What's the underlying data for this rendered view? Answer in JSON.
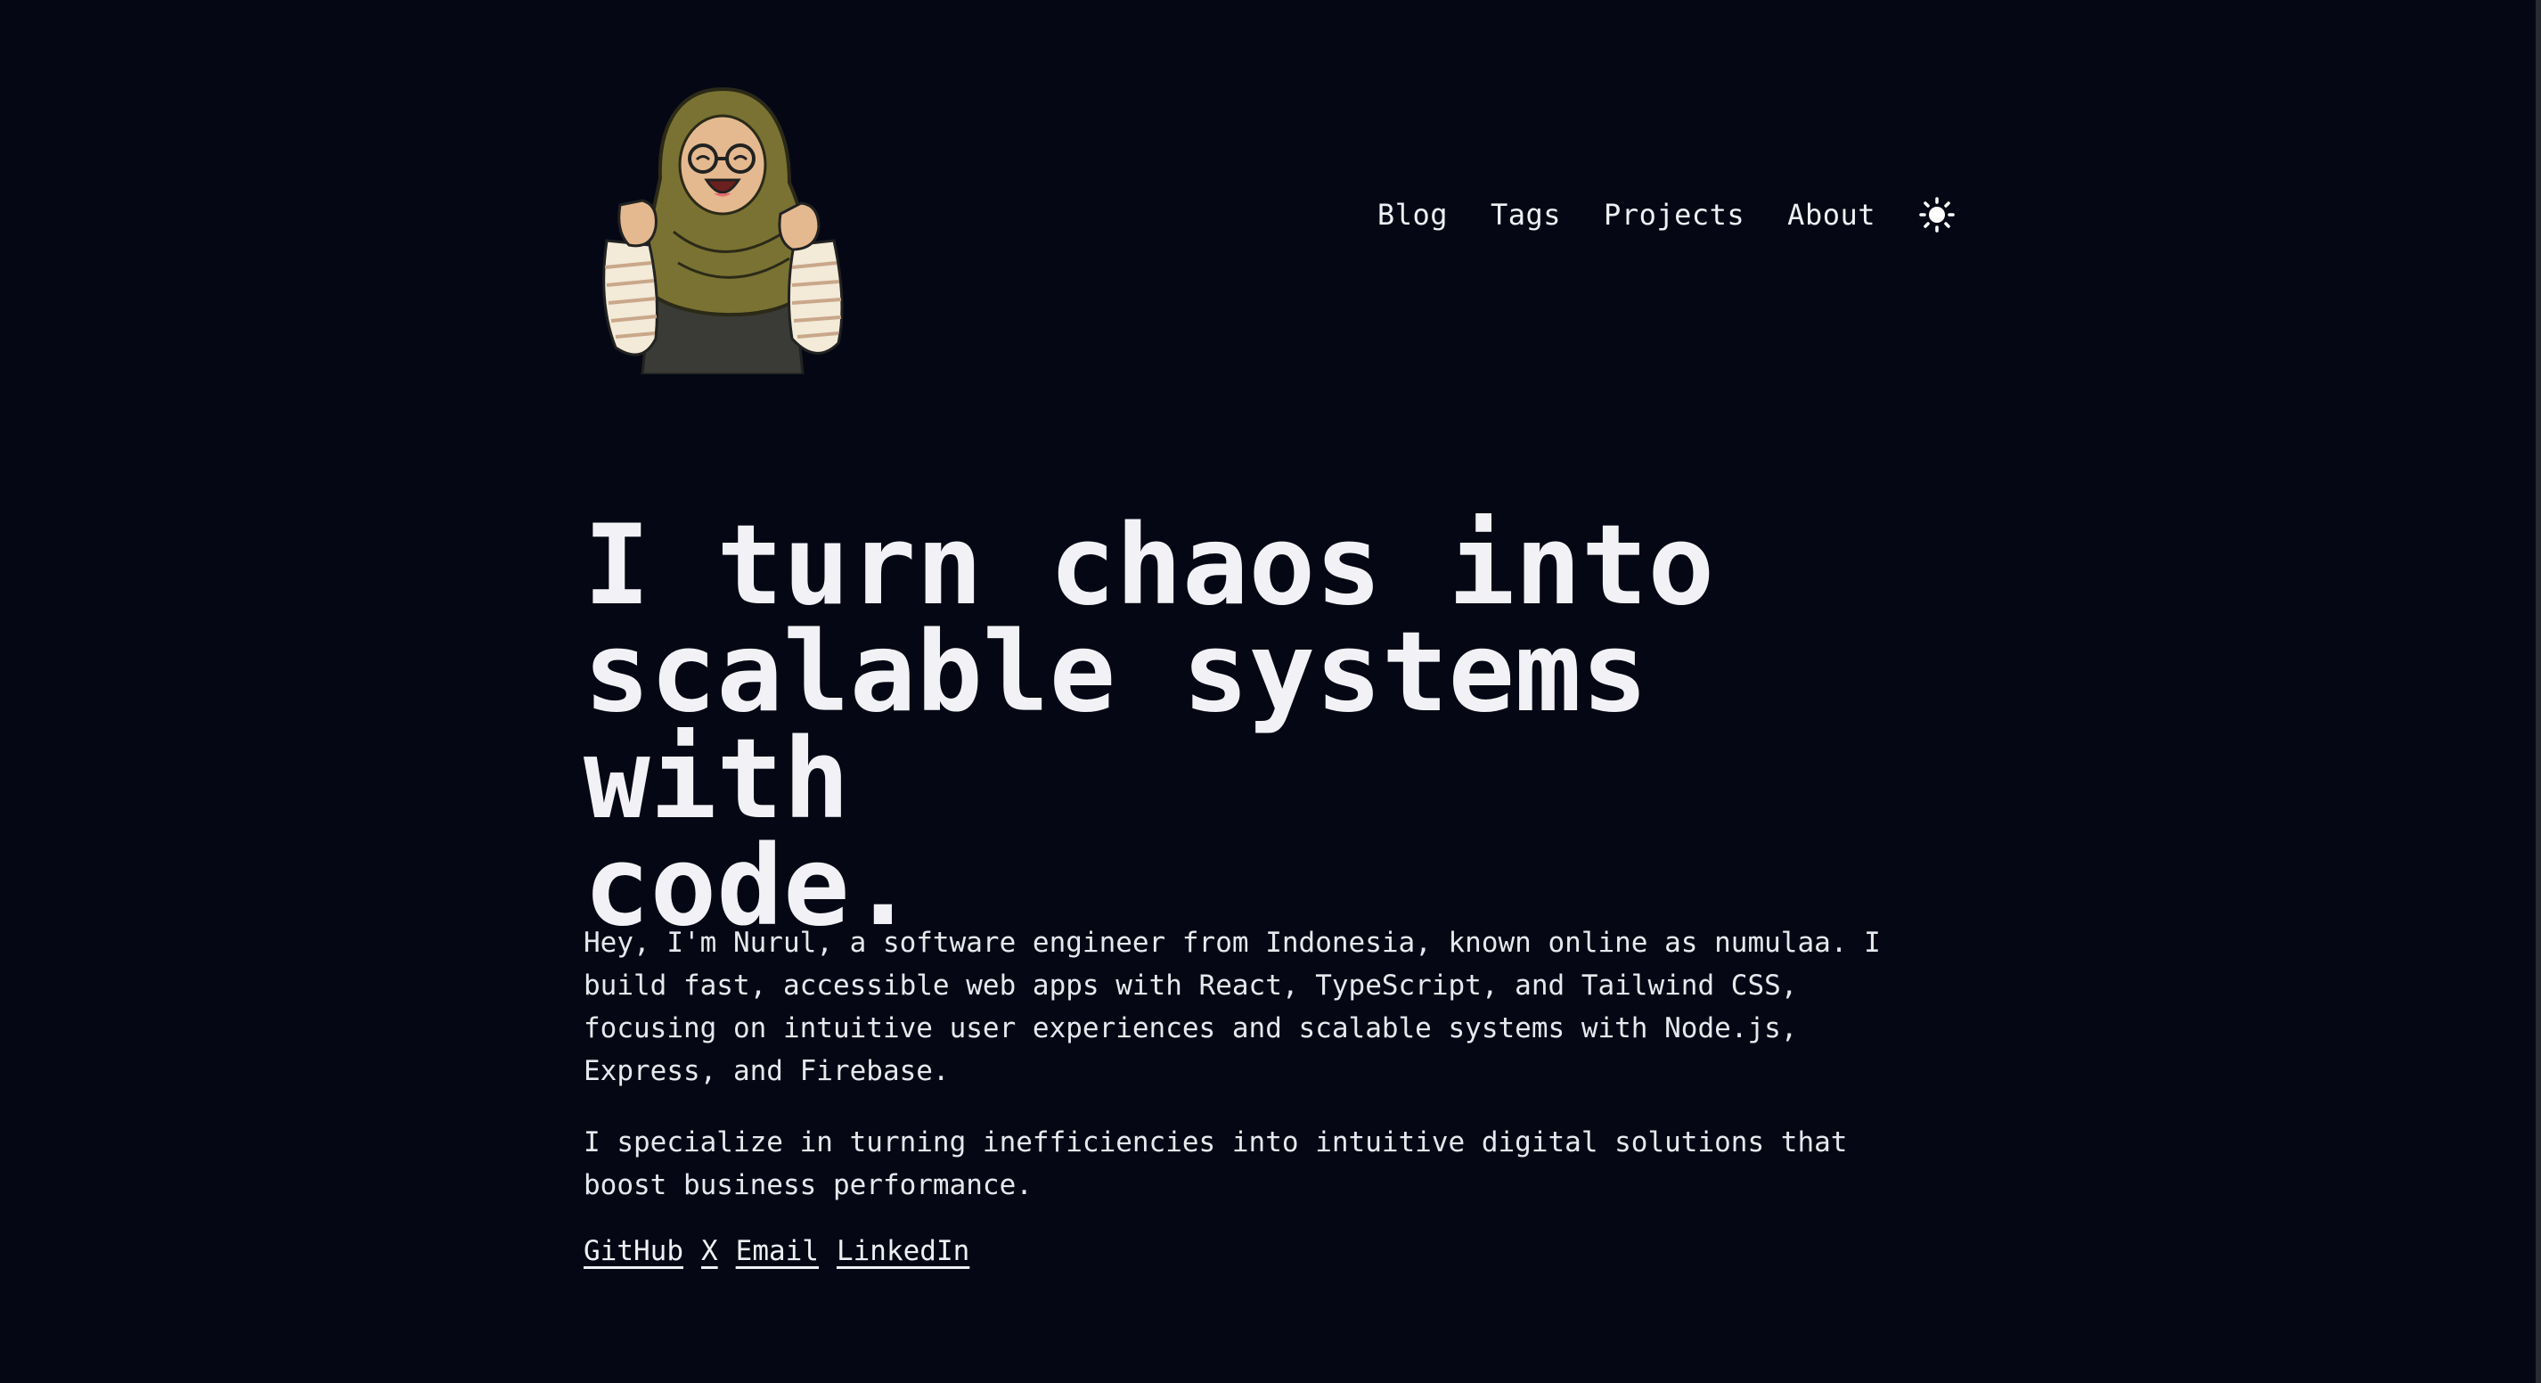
{
  "header": {
    "nav": [
      {
        "label": "Blog"
      },
      {
        "label": "Tags"
      },
      {
        "label": "Projects"
      },
      {
        "label": "About"
      }
    ],
    "theme_toggle_icon": "sun-icon"
  },
  "hero": {
    "headline_line1": "I turn chaos into",
    "headline_line2": "scalable systems with",
    "headline_line3": "code."
  },
  "bio": {
    "paragraph1_line1": "Hey, I'm Nurul, a software engineer from Indonesia, known online as numulaa. I",
    "paragraph1_line2": "build fast, accessible web apps with React, TypeScript, and Tailwind CSS,",
    "paragraph1_line3": "focusing on intuitive user experiences and scalable systems with Node.js,",
    "paragraph1_line4": "Express, and Firebase.",
    "paragraph2_line1": "I specialize in turning inefficiencies into intuitive digital solutions that",
    "paragraph2_line2": "boost business performance."
  },
  "social": {
    "links": [
      {
        "label": "GitHub"
      },
      {
        "label": "X"
      },
      {
        "label": "Email"
      },
      {
        "label": "LinkedIn"
      }
    ]
  },
  "colors": {
    "background": "#050814",
    "text": "#eef0f5",
    "hijab": "#7a7232"
  }
}
